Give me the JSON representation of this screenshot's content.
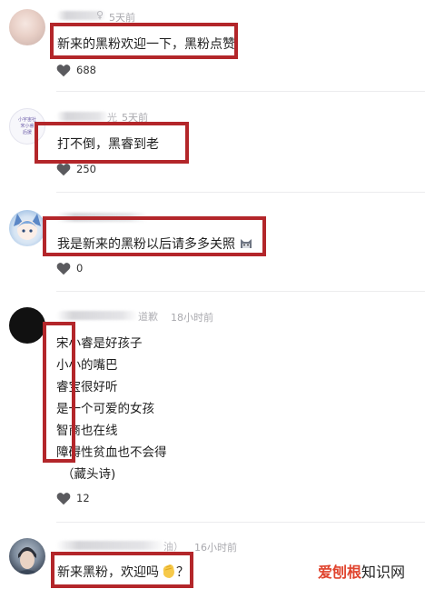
{
  "comments": [
    {
      "time": "5天前",
      "name_tail": "♀",
      "text": "新来的黑粉欢迎一下，黑粉点赞",
      "likes": "688",
      "avatar": "blurred-portrait"
    },
    {
      "time": "5天前",
      "name_tail": "光",
      "text": "打不倒，黑睿到老",
      "likes": "250",
      "avatar": "round-seal",
      "avatar_text": "小宇宙社\n宋小睿\n后援"
    },
    {
      "time": "",
      "text": "我是新来的黑粉以后请多多关照",
      "emoji": "cat-face-icon",
      "likes": "0",
      "avatar": "anime-character"
    },
    {
      "name_tail": "道歉",
      "time": "18小时前",
      "poem": [
        "宋小睿是好孩子",
        "小小的嘴巴",
        "睿宝很好听",
        "是一个可爱的女孩",
        "智商也在线",
        "障碍性贫血也不会得",
        "（藏头诗)"
      ],
      "likes": "12",
      "avatar": "black"
    },
    {
      "name_tail": "油）",
      "time": "16小时前",
      "text": "新来黑粉，欢迎吗",
      "emoji": "clapping-hands-icon",
      "text_suffix": "？",
      "avatar": "portrait"
    }
  ],
  "watermark": {
    "part1": "爱刨根",
    "part2": "知识网"
  },
  "colors": {
    "highlight_box": "#b3262a",
    "watermark_accent": "#e0442e"
  }
}
